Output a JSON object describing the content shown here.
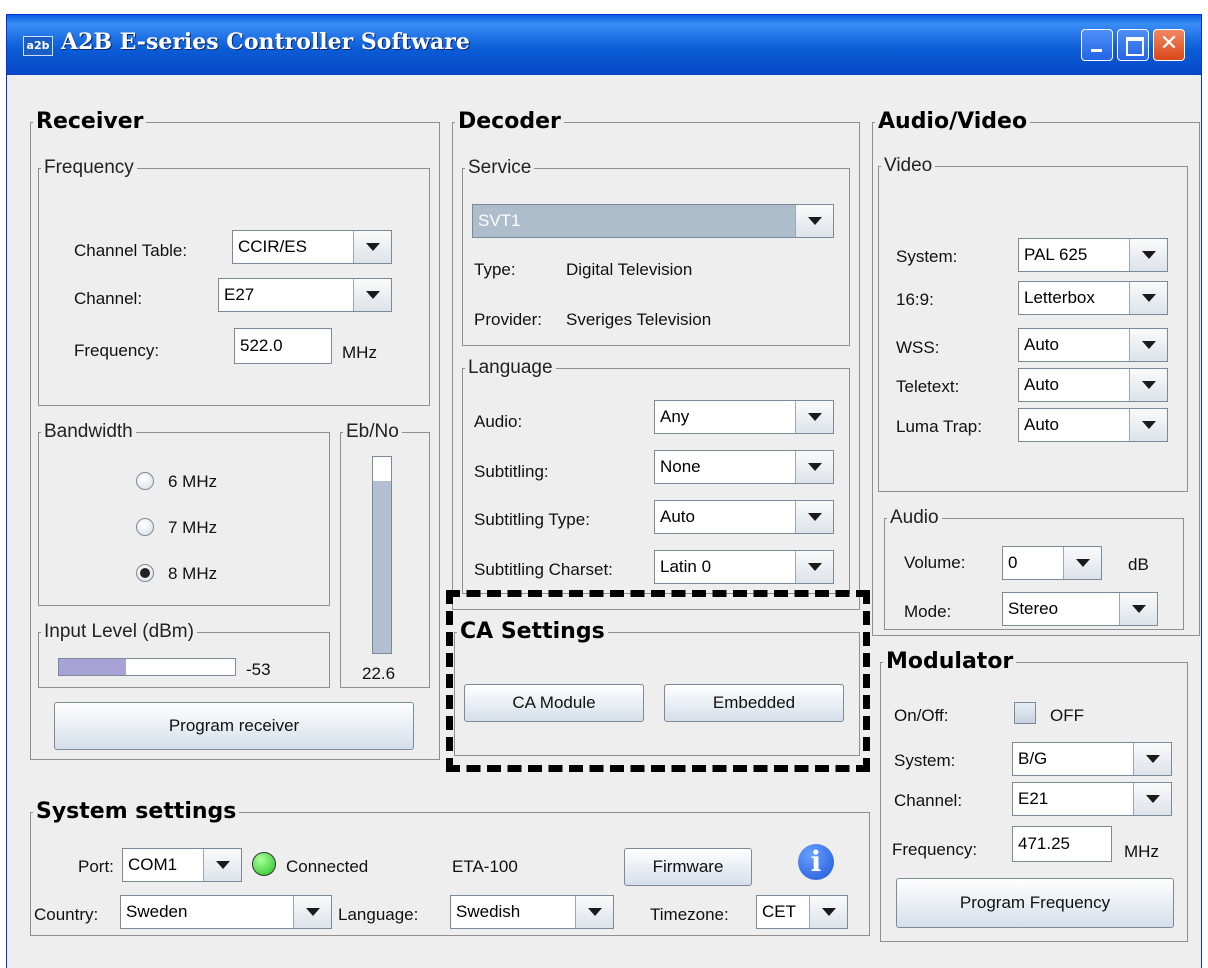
{
  "window": {
    "icon_text": "a2b",
    "title": "A2B E-series Controller Software"
  },
  "receiver": {
    "title": "Receiver",
    "frequency_group": {
      "title": "Frequency",
      "channel_table_label": "Channel Table:",
      "channel_table_value": "CCIR/ES",
      "channel_label": "Channel:",
      "channel_value": "E27",
      "frequency_label": "Frequency:",
      "frequency_value": "522.0",
      "frequency_unit": "MHz"
    },
    "bandwidth": {
      "title": "Bandwidth",
      "options": [
        "6 MHz",
        "7 MHz",
        "8 MHz"
      ],
      "selected": "8 MHz"
    },
    "ebno": {
      "title": "Eb/No",
      "value": "22.6",
      "level_fraction": 0.88
    },
    "input_level": {
      "title": "Input Level (dBm)",
      "value": "-53",
      "level_fraction": 0.38
    },
    "program_button": "Program receiver"
  },
  "decoder": {
    "title": "Decoder",
    "service": {
      "title": "Service",
      "value": "SVT1",
      "type_label": "Type:",
      "type_value": "Digital Television",
      "provider_label": "Provider:",
      "provider_value": "Sveriges Television"
    },
    "language": {
      "title": "Language",
      "audio_label": "Audio:",
      "audio_value": "Any",
      "subtitling_label": "Subtitling:",
      "subtitling_value": "None",
      "subtitling_type_label": "Subtitling Type:",
      "subtitling_type_value": "Auto",
      "subtitling_charset_label": "Subtitling Charset:",
      "subtitling_charset_value": "Latin 0"
    }
  },
  "ca_settings": {
    "title": "CA Settings",
    "ca_module_button": "CA Module",
    "embedded_button": "Embedded"
  },
  "audio_video": {
    "title": "Audio/Video",
    "video": {
      "title": "Video",
      "system_label": "System:",
      "system_value": "PAL 625",
      "ratio_label": "16:9:",
      "ratio_value": "Letterbox",
      "wss_label": "WSS:",
      "wss_value": "Auto",
      "teletext_label": "Teletext:",
      "teletext_value": "Auto",
      "luma_label": "Luma Trap:",
      "luma_value": "Auto"
    },
    "audio": {
      "title": "Audio",
      "volume_label": "Volume:",
      "volume_value": "0",
      "volume_unit": "dB",
      "mode_label": "Mode:",
      "mode_value": "Stereo"
    }
  },
  "modulator": {
    "title": "Modulator",
    "onoff_label": "On/Off:",
    "onoff_state": "OFF",
    "system_label": "System:",
    "system_value": "B/G",
    "channel_label": "Channel:",
    "channel_value": "E21",
    "frequency_label": "Frequency:",
    "frequency_value": "471.25",
    "frequency_unit": "MHz",
    "program_button": "Program Frequency"
  },
  "system_settings": {
    "title": "System settings",
    "port_label": "Port:",
    "port_value": "COM1",
    "status_text": "Connected",
    "status_color": "#22c322",
    "device": "ETA-100",
    "firmware_button": "Firmware",
    "info_icon_text": "i",
    "country_label": "Country:",
    "country_value": "Sweden",
    "language_label": "Language:",
    "language_value": "Swedish",
    "timezone_label": "Timezone:",
    "timezone_value": "CET"
  }
}
